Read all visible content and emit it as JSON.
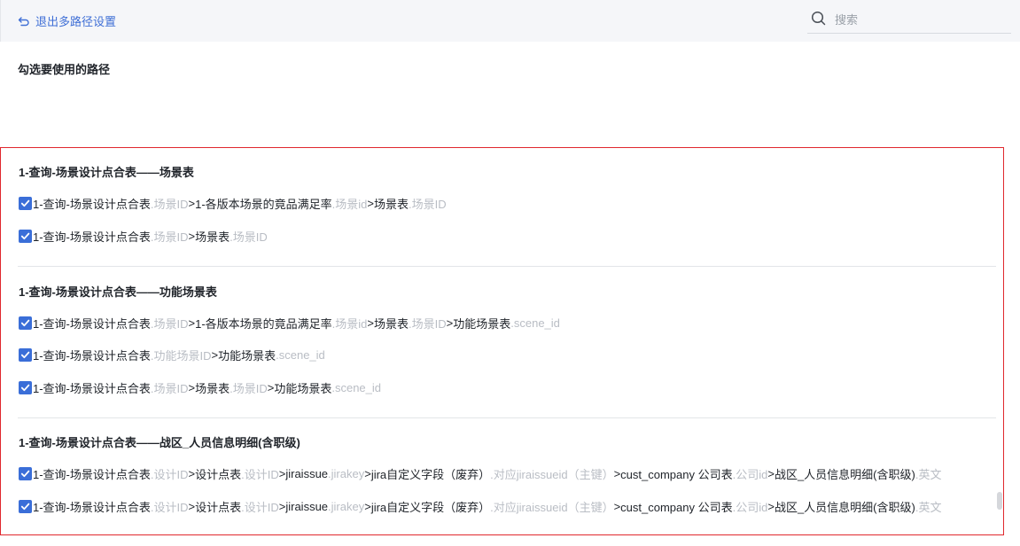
{
  "header": {
    "exit_label": "退出多路径设置",
    "search_placeholder": "搜索"
  },
  "hint": "勾选要使用的路径",
  "colors": {
    "accent": "#3a6ed8",
    "highlight_border": "#e0282e",
    "field_text": "#b9bdc4"
  },
  "groups": [
    {
      "title": "1-查询-场景设计点合表——场景表",
      "paths": [
        {
          "checked": true,
          "segments": [
            {
              "t": "1-查询-场景设计点合表",
              "k": "t"
            },
            {
              "t": ".场景ID",
              "k": "f"
            },
            {
              "t": ">",
              "k": "a"
            },
            {
              "t": "1-各版本场景的竟品满足率",
              "k": "t"
            },
            {
              "t": ".场景id",
              "k": "f"
            },
            {
              "t": ">",
              "k": "a"
            },
            {
              "t": "场景表",
              "k": "t"
            },
            {
              "t": ".场景ID",
              "k": "f"
            }
          ]
        },
        {
          "checked": true,
          "segments": [
            {
              "t": "1-查询-场景设计点合表",
              "k": "t"
            },
            {
              "t": ".场景ID",
              "k": "f"
            },
            {
              "t": ">",
              "k": "a"
            },
            {
              "t": "场景表",
              "k": "t"
            },
            {
              "t": ".场景ID",
              "k": "f"
            }
          ]
        }
      ]
    },
    {
      "title": "1-查询-场景设计点合表——功能场景表",
      "paths": [
        {
          "checked": true,
          "segments": [
            {
              "t": "1-查询-场景设计点合表",
              "k": "t"
            },
            {
              "t": ".场景ID",
              "k": "f"
            },
            {
              "t": ">",
              "k": "a"
            },
            {
              "t": "1-各版本场景的竟品满足率",
              "k": "t"
            },
            {
              "t": ".场景id",
              "k": "f"
            },
            {
              "t": ">",
              "k": "a"
            },
            {
              "t": "场景表",
              "k": "t"
            },
            {
              "t": ".场景ID",
              "k": "f"
            },
            {
              "t": ">",
              "k": "a"
            },
            {
              "t": "功能场景表",
              "k": "t"
            },
            {
              "t": ".scene_id",
              "k": "f"
            }
          ]
        },
        {
          "checked": true,
          "segments": [
            {
              "t": "1-查询-场景设计点合表",
              "k": "t"
            },
            {
              "t": ".功能场景ID",
              "k": "f"
            },
            {
              "t": ">",
              "k": "a"
            },
            {
              "t": "功能场景表",
              "k": "t"
            },
            {
              "t": ".scene_id",
              "k": "f"
            }
          ]
        },
        {
          "checked": true,
          "segments": [
            {
              "t": "1-查询-场景设计点合表",
              "k": "t"
            },
            {
              "t": ".场景ID",
              "k": "f"
            },
            {
              "t": ">",
              "k": "a"
            },
            {
              "t": "场景表",
              "k": "t"
            },
            {
              "t": ".场景ID",
              "k": "f"
            },
            {
              "t": ">",
              "k": "a"
            },
            {
              "t": "功能场景表",
              "k": "t"
            },
            {
              "t": ".scene_id",
              "k": "f"
            }
          ]
        }
      ]
    },
    {
      "title": "1-查询-场景设计点合表——战区_人员信息明细(含职级)",
      "paths": [
        {
          "checked": true,
          "segments": [
            {
              "t": "1-查询-场景设计点合表",
              "k": "t"
            },
            {
              "t": ".设计ID",
              "k": "f"
            },
            {
              "t": ">",
              "k": "a"
            },
            {
              "t": "设计点表",
              "k": "t"
            },
            {
              "t": ".设计ID",
              "k": "f"
            },
            {
              "t": ">",
              "k": "a"
            },
            {
              "t": "jiraissue",
              "k": "t"
            },
            {
              "t": ".jirakey",
              "k": "f"
            },
            {
              "t": ">",
              "k": "a"
            },
            {
              "t": "jira自定义字段（废弃）",
              "k": "t"
            },
            {
              "t": ".对应jiraissueid（主键）",
              "k": "f"
            },
            {
              "t": ">",
              "k": "a"
            },
            {
              "t": "cust_company 公司表",
              "k": "t"
            },
            {
              "t": ".公司id",
              "k": "f"
            },
            {
              "t": ">",
              "k": "a"
            },
            {
              "t": "战区_人员信息明细(含职级)",
              "k": "t"
            },
            {
              "t": ".英文",
              "k": "f"
            }
          ]
        },
        {
          "checked": true,
          "segments": [
            {
              "t": "1-查询-场景设计点合表",
              "k": "t"
            },
            {
              "t": ".设计ID",
              "k": "f"
            },
            {
              "t": ">",
              "k": "a"
            },
            {
              "t": "设计点表",
              "k": "t"
            },
            {
              "t": ".设计ID",
              "k": "f"
            },
            {
              "t": ">",
              "k": "a"
            },
            {
              "t": "jiraissue",
              "k": "t"
            },
            {
              "t": ".jirakey",
              "k": "f"
            },
            {
              "t": ">",
              "k": "a"
            },
            {
              "t": "jira自定义字段（废弃）",
              "k": "t"
            },
            {
              "t": ".对应jiraissueid（主键）",
              "k": "f"
            },
            {
              "t": ">",
              "k": "a"
            },
            {
              "t": "cust_company 公司表",
              "k": "t"
            },
            {
              "t": ".公司id",
              "k": "f"
            },
            {
              "t": ">",
              "k": "a"
            },
            {
              "t": "战区_人员信息明细(含职级)",
              "k": "t"
            },
            {
              "t": ".英文",
              "k": "f"
            }
          ]
        }
      ]
    }
  ]
}
